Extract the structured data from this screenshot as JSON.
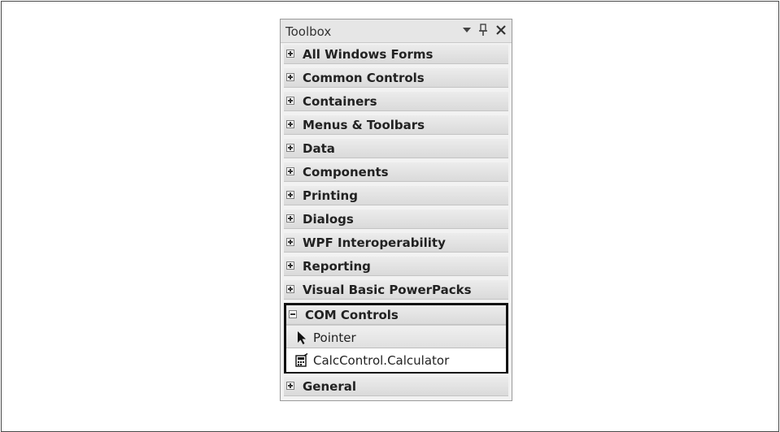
{
  "toolbox": {
    "title": "Toolbox",
    "buttons": {
      "dropdown_icon": "triangle-down-icon",
      "pin_icon": "pin-icon",
      "close_icon": "close-icon"
    },
    "categories": [
      {
        "label": "All Windows Forms",
        "expanded": false
      },
      {
        "label": "Common Controls",
        "expanded": false
      },
      {
        "label": "Containers",
        "expanded": false
      },
      {
        "label": "Menus & Toolbars",
        "expanded": false
      },
      {
        "label": "Data",
        "expanded": false
      },
      {
        "label": "Components",
        "expanded": false
      },
      {
        "label": "Printing",
        "expanded": false
      },
      {
        "label": "Dialogs",
        "expanded": false
      },
      {
        "label": "WPF Interoperability",
        "expanded": false
      },
      {
        "label": "Reporting",
        "expanded": false
      },
      {
        "label": "Visual Basic PowerPacks",
        "expanded": false
      }
    ],
    "com_controls": {
      "label": "COM Controls",
      "expanded": true,
      "items": [
        {
          "label": "Pointer",
          "icon": "pointer-arrow-icon"
        },
        {
          "label": "CalcControl.Calculator",
          "icon": "calculator-control-icon"
        }
      ]
    },
    "general": {
      "label": "General",
      "expanded": false
    }
  }
}
